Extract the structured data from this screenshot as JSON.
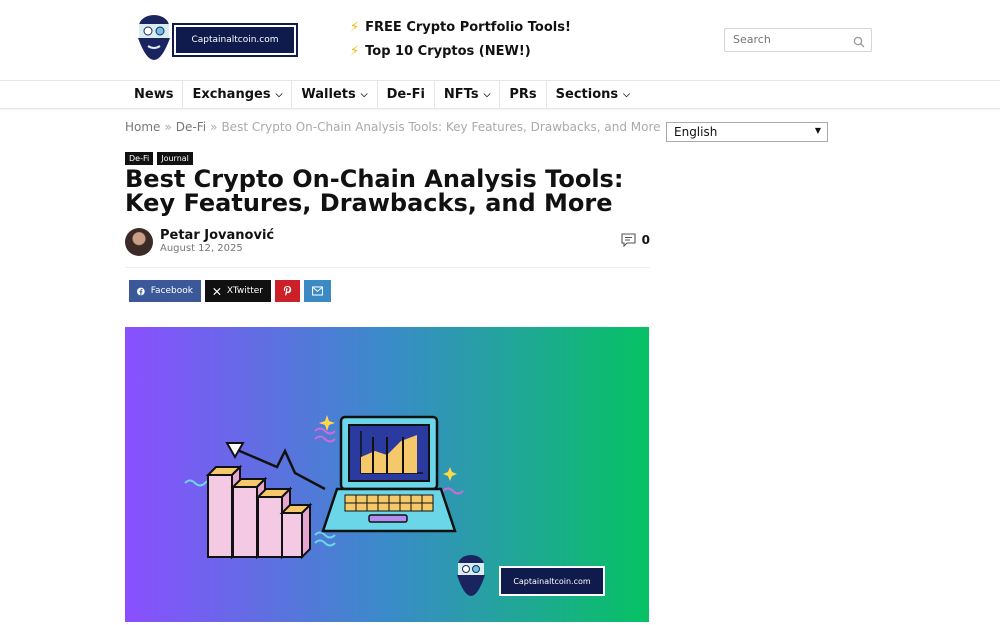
{
  "header": {
    "logo_text": "Captainaltcoin.com",
    "promo1": "FREE Crypto Portfolio Tools!",
    "promo2": "Top 10 Cryptos (NEW!)",
    "search_placeholder": "Search"
  },
  "nav": {
    "items": [
      {
        "label": "News"
      },
      {
        "label": "Exchanges"
      },
      {
        "label": "Wallets"
      },
      {
        "label": "De-Fi"
      },
      {
        "label": "NFTs"
      },
      {
        "label": "PRs"
      },
      {
        "label": "Sections"
      }
    ]
  },
  "breadcrumb": {
    "home": "Home",
    "category": "De-Fi",
    "current": "Best Crypto On-Chain Analysis Tools: Key Features, Drawbacks, and More"
  },
  "article": {
    "tags": [
      "De-Fi",
      "Journal"
    ],
    "title": "Best Crypto On-Chain Analysis Tools: Key Features, Drawbacks, and More",
    "author": "Petar Jovanović",
    "date": "August 12, 2025",
    "comment_count": "0"
  },
  "share": {
    "facebook": "Facebook",
    "twitter": "XTwitter"
  },
  "hero": {
    "logo_text": "Captainaltcoin.com"
  },
  "language": {
    "selected": "English"
  },
  "colors": {
    "brand_navy": "#0f1b4d",
    "facebook": "#3b5998",
    "pinterest": "#cb2027",
    "mail": "#3c8ac4",
    "gradient_start": "#8a4fff",
    "gradient_end": "#06c264"
  }
}
